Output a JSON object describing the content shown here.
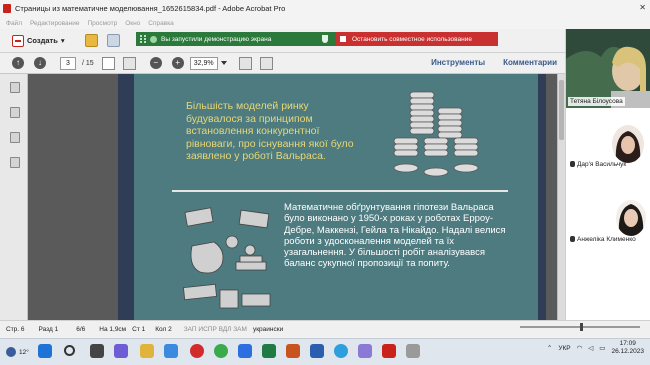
{
  "window": {
    "title": "Страницы из математичне моделювання_1652615834.pdf - Adobe Acrobat Pro",
    "close_glyph": "✕"
  },
  "menu": [
    "Файл",
    "Редактирование",
    "Просмотр",
    "Окно",
    "Справка"
  ],
  "toolbar": {
    "create_label": "Создать"
  },
  "share_banner": {
    "status_text": "Вы запустили демонстрацию экрана",
    "stop_text": "Остановить совместное использование"
  },
  "nav": {
    "page_current": "3",
    "page_total": "/ 15",
    "zoom_value": "32,9%",
    "tools_label": "Инструменты",
    "comments_label": "Комментарии"
  },
  "slide": {
    "para1": "Більшість моделей ринку будувалося за принципом встановлення конкурентної рівноваги, про існування якої було заявлено у роботі Вальраса.",
    "para2": "Математичне обґрунтування гіпотези Вальраса було виконано у 1950-х роках у роботах Ерроу-Дебре, Маккензі, Гейла та Нікайдо. Надалі велися роботи з удосконалення моделей та їх узагальнення. У більшості робіт аналізувався баланс сукупної пропозиції та попиту."
  },
  "participants": [
    {
      "name": "Тетяна Білоусова"
    },
    {
      "name": "Дар'я Васильчук"
    },
    {
      "name": "Анжеліка Клименко"
    }
  ],
  "statusbar": {
    "page": "Стр. 6",
    "section": "Разд 1",
    "pages": "6/6",
    "position": "На 1,9см",
    "line": "Ст 1",
    "column": "Кол 2",
    "modes": "ЗАП ИСПР ВДЛ ЗАМ",
    "language": "украински"
  },
  "taskbar": {
    "temperature": "12°",
    "lang": "УКР",
    "time": "17:09",
    "date": "26.12.2023"
  },
  "colors": {
    "slide_bg": "#4d7b80",
    "slide_title_text": "#e8d775",
    "share_green": "#2b7a3c",
    "share_red": "#c93030"
  }
}
